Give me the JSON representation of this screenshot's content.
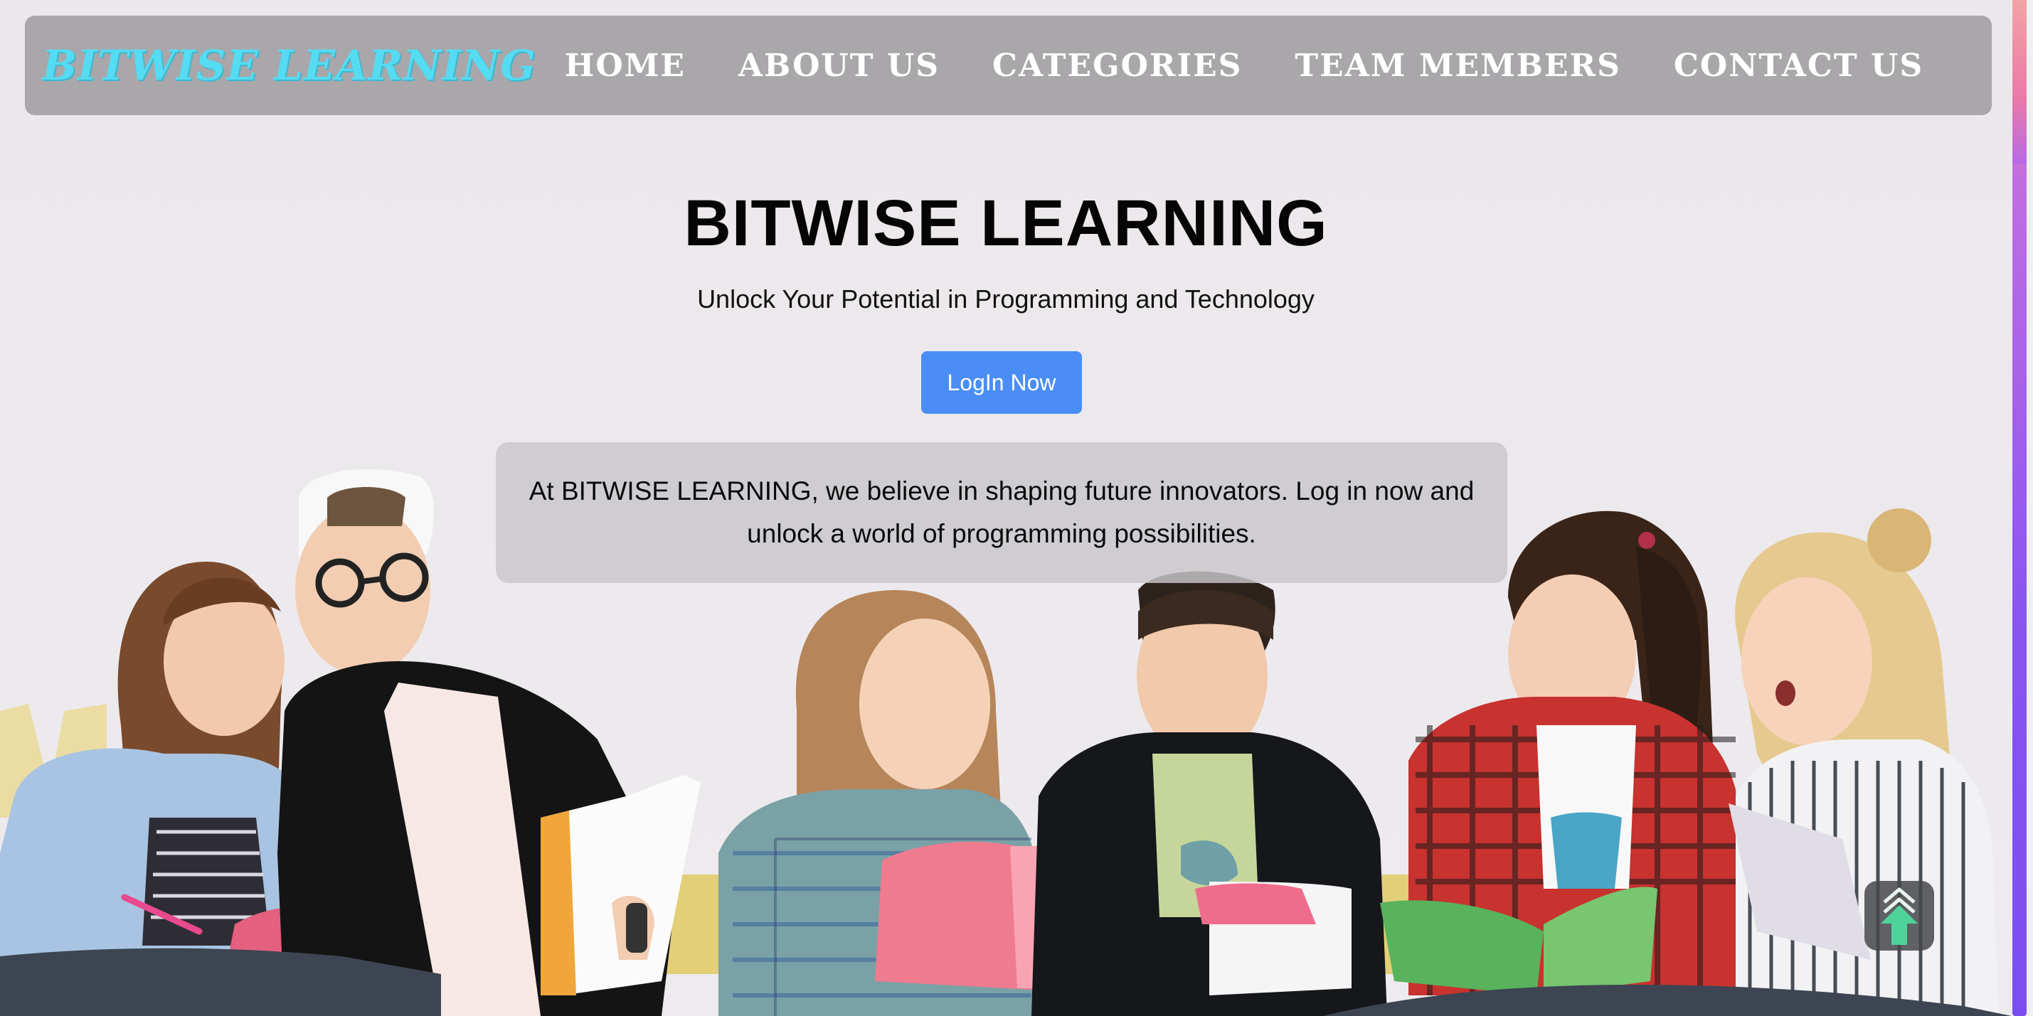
{
  "nav": {
    "brand": "BITWISE LEARNING",
    "links": [
      "HOME",
      "ABOUT US",
      "CATEGORIES",
      "TEAM MEMBERS",
      "CONTACT US"
    ]
  },
  "hero": {
    "title": "BITWISE LEARNING",
    "subtitle": "Unlock Your Potential in Programming and Technology",
    "login_label": "LogIn Now",
    "about_text": "At BITWISE LEARNING, we believe in shaping future innovators. Log in now and unlock a world of programming possibilities."
  },
  "colors": {
    "brand": "#55dbf2",
    "navbar_bg": "#a9a7aa",
    "login_button": "#4a8ef5",
    "scroll_arrow": "#4fd39a"
  },
  "icons": {
    "scroll_top": "double-chevron-up-arrow-icon"
  }
}
